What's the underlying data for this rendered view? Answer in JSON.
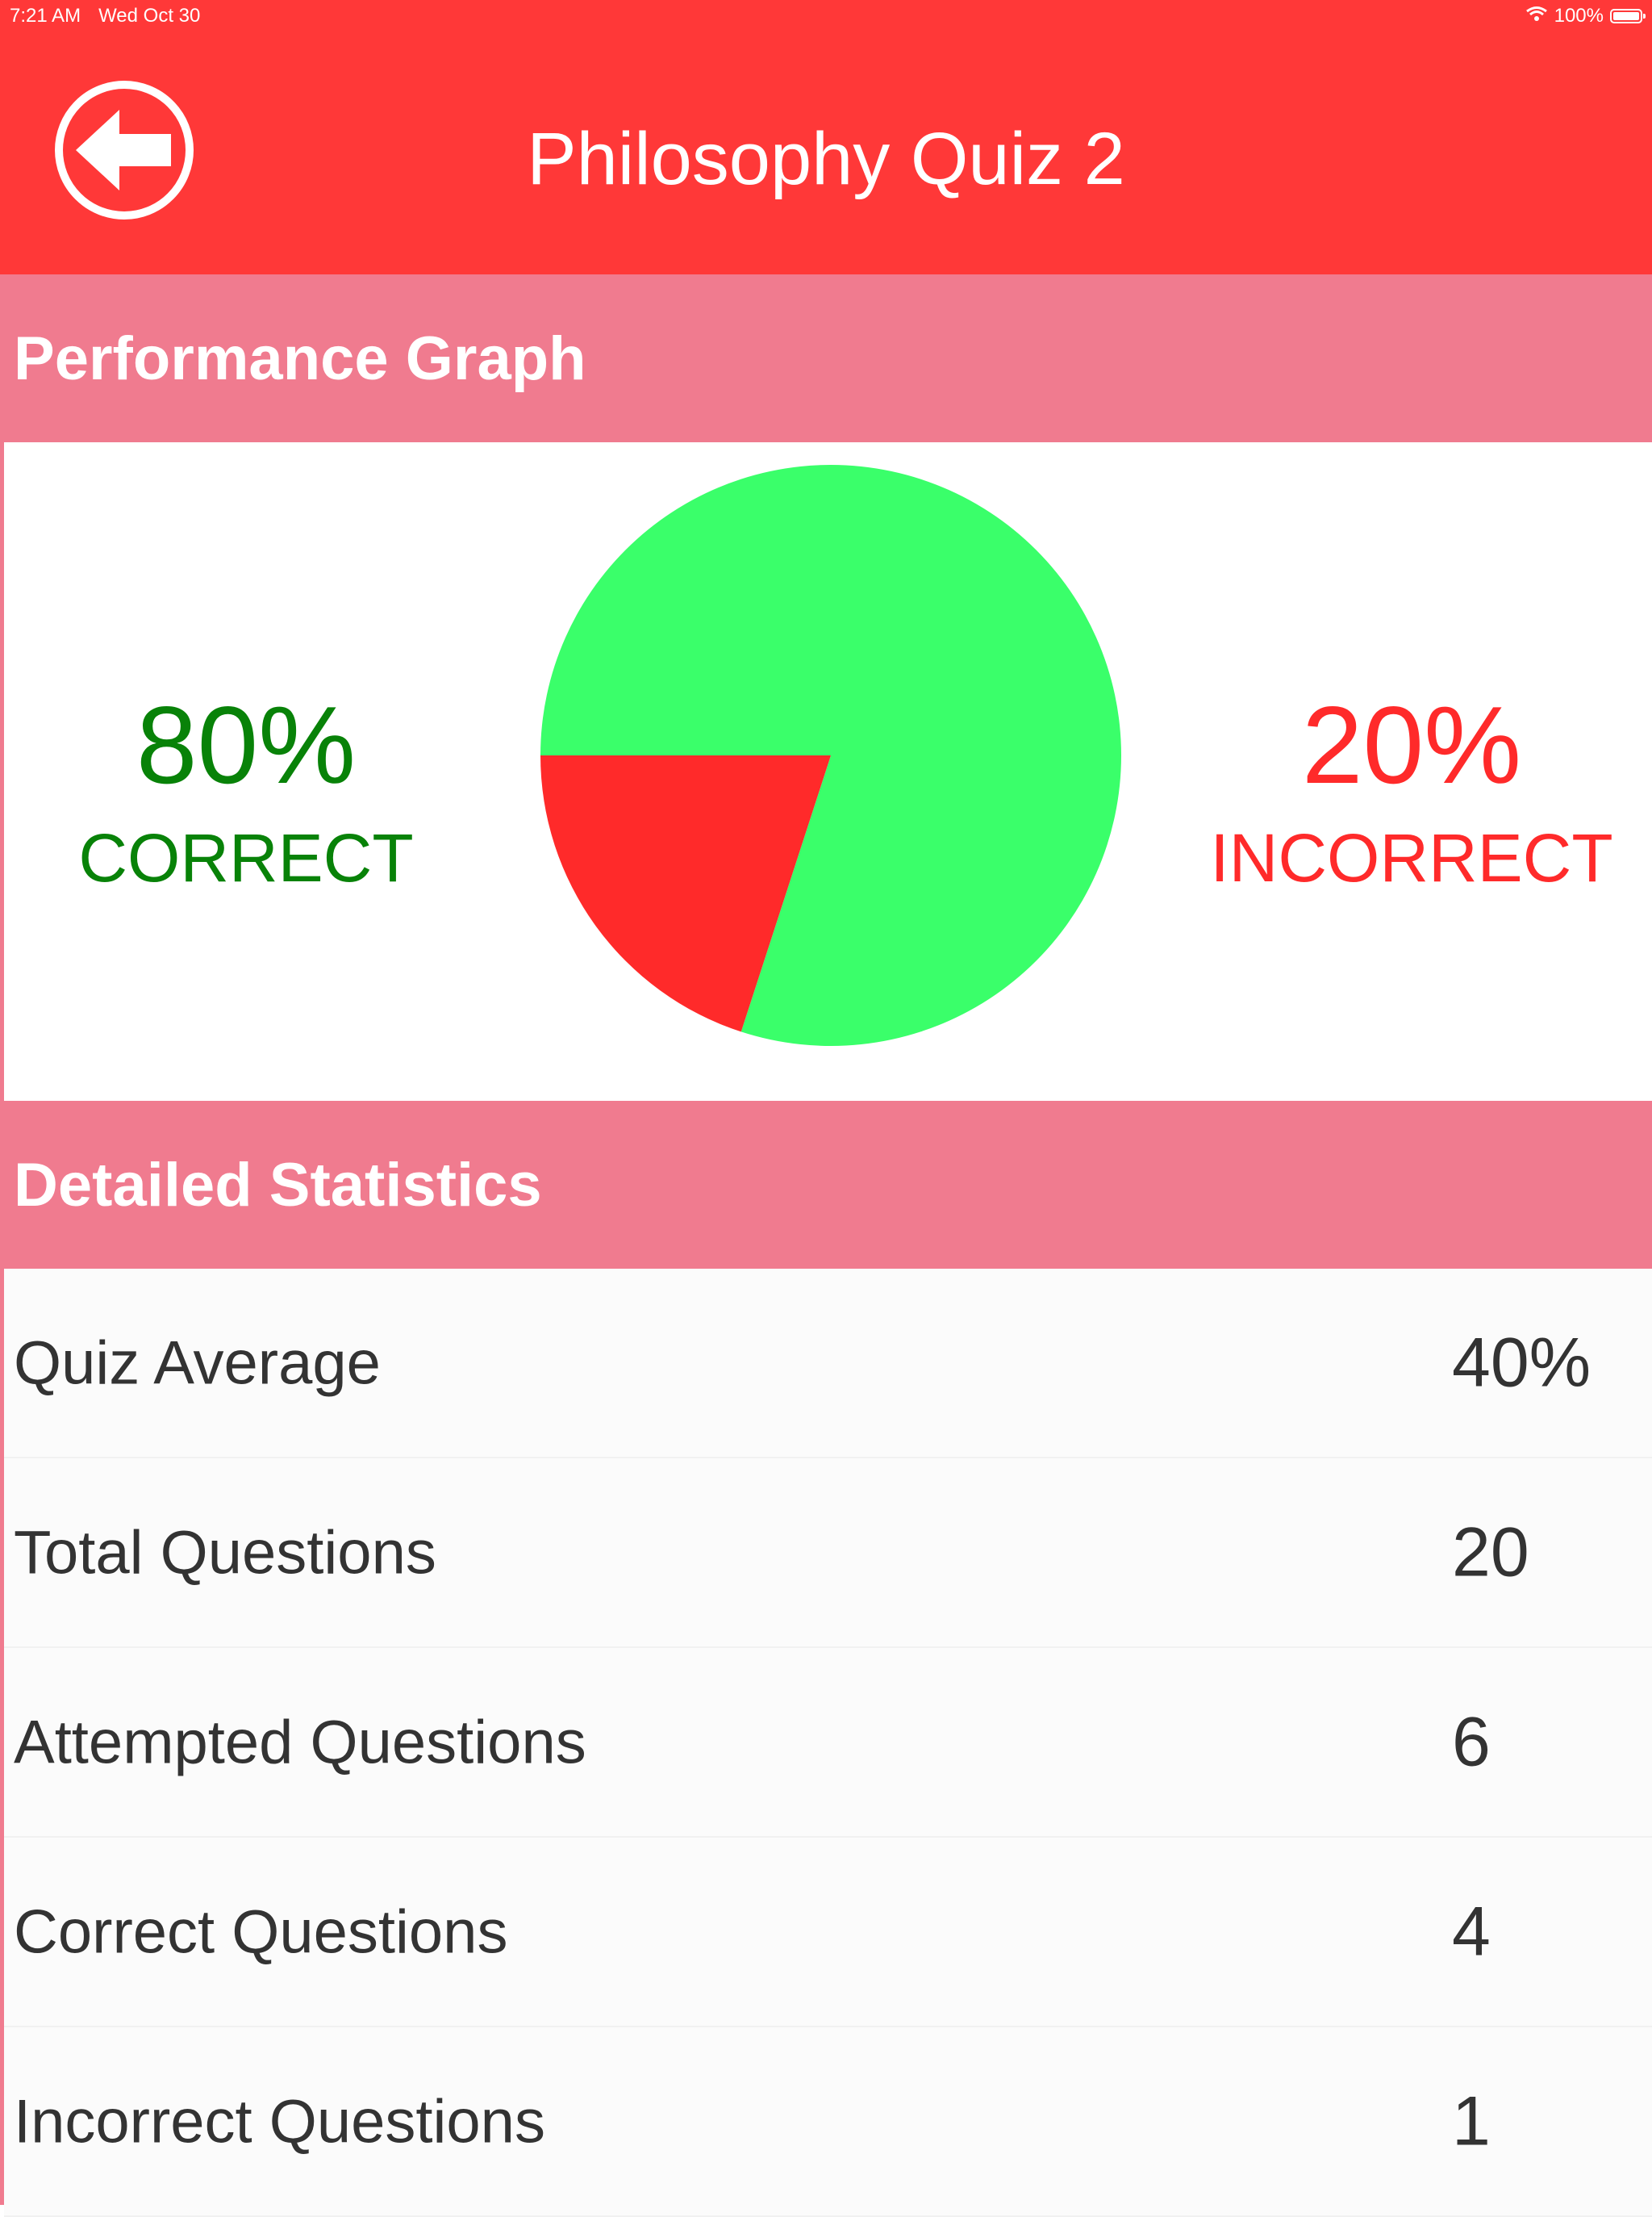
{
  "status_bar": {
    "time": "7:21 AM",
    "date": "Wed Oct 30",
    "battery": "100%"
  },
  "nav": {
    "title": "Philosophy Quiz 2"
  },
  "sections": {
    "graph_title": "Performance Graph",
    "stats_title": "Detailed Statistics"
  },
  "performance": {
    "correct_percent": "80%",
    "correct_label": "CORRECT",
    "incorrect_percent": "20%",
    "incorrect_label": "INCORRECT"
  },
  "chart_data": {
    "type": "pie",
    "slices": [
      {
        "value": 80,
        "color": "#3aff6a"
      },
      {
        "value": 20,
        "color": "#ff2a2a"
      }
    ]
  },
  "stats": [
    {
      "label": "Quiz Average",
      "value": "40%"
    },
    {
      "label": "Total Questions",
      "value": "20"
    },
    {
      "label": "Attempted Questions",
      "value": "6"
    },
    {
      "label": "Correct Questions",
      "value": "4"
    },
    {
      "label": "Incorrect Questions",
      "value": "1"
    }
  ],
  "colors": {
    "primary": "#ff3838",
    "section_header": "#f07b8f",
    "correct_text": "#088208",
    "incorrect_text": "#ff2a2a"
  }
}
